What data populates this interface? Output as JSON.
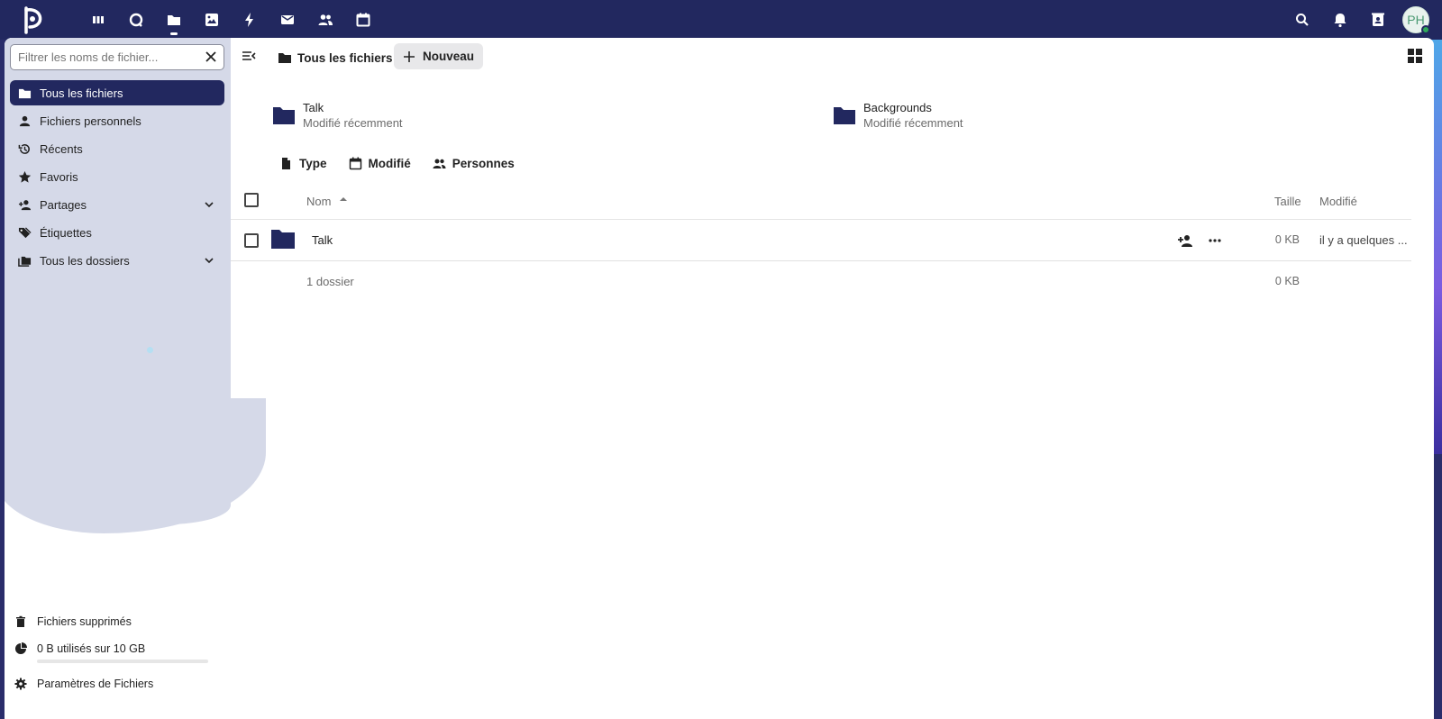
{
  "header": {
    "apps": [
      "dashboard-icon",
      "talk-icon",
      "files-icon",
      "photos-icon",
      "activity-icon",
      "mail-icon",
      "contacts-icon",
      "calendar-icon"
    ],
    "active_app": "files-icon",
    "avatar_initials": "PH"
  },
  "sidebar": {
    "filter_placeholder": "Filtrer les noms de fichier...",
    "items": [
      {
        "label": "Tous les fichiers"
      },
      {
        "label": "Fichiers personnels"
      },
      {
        "label": "Récents"
      },
      {
        "label": "Favoris"
      },
      {
        "label": "Partages"
      },
      {
        "label": "Étiquettes"
      },
      {
        "label": "Tous les dossiers"
      }
    ],
    "trash_label": "Fichiers supprimés",
    "quota_label": "0 B utilisés sur 10 GB",
    "settings_label": "Paramètres de Fichiers"
  },
  "toolbar": {
    "breadcrumb": "Tous les fichiers",
    "new_label": "Nouveau"
  },
  "recent": [
    {
      "name": "Talk",
      "sub": "Modifié récemment"
    },
    {
      "name": "Backgrounds",
      "sub": "Modifié récemment"
    }
  ],
  "filters": {
    "type": "Type",
    "modified": "Modifié",
    "people": "Personnes"
  },
  "table": {
    "col_name": "Nom",
    "col_size": "Taille",
    "col_modified": "Modifié",
    "rows": [
      {
        "name": "Talk",
        "size": "0 KB",
        "modified": "il y a quelques ..."
      }
    ],
    "summary_count": "1 dossier",
    "summary_size": "0 KB"
  },
  "colors": {
    "primary": "#22285f",
    "sidebar_bg": "#d5d9e8"
  }
}
